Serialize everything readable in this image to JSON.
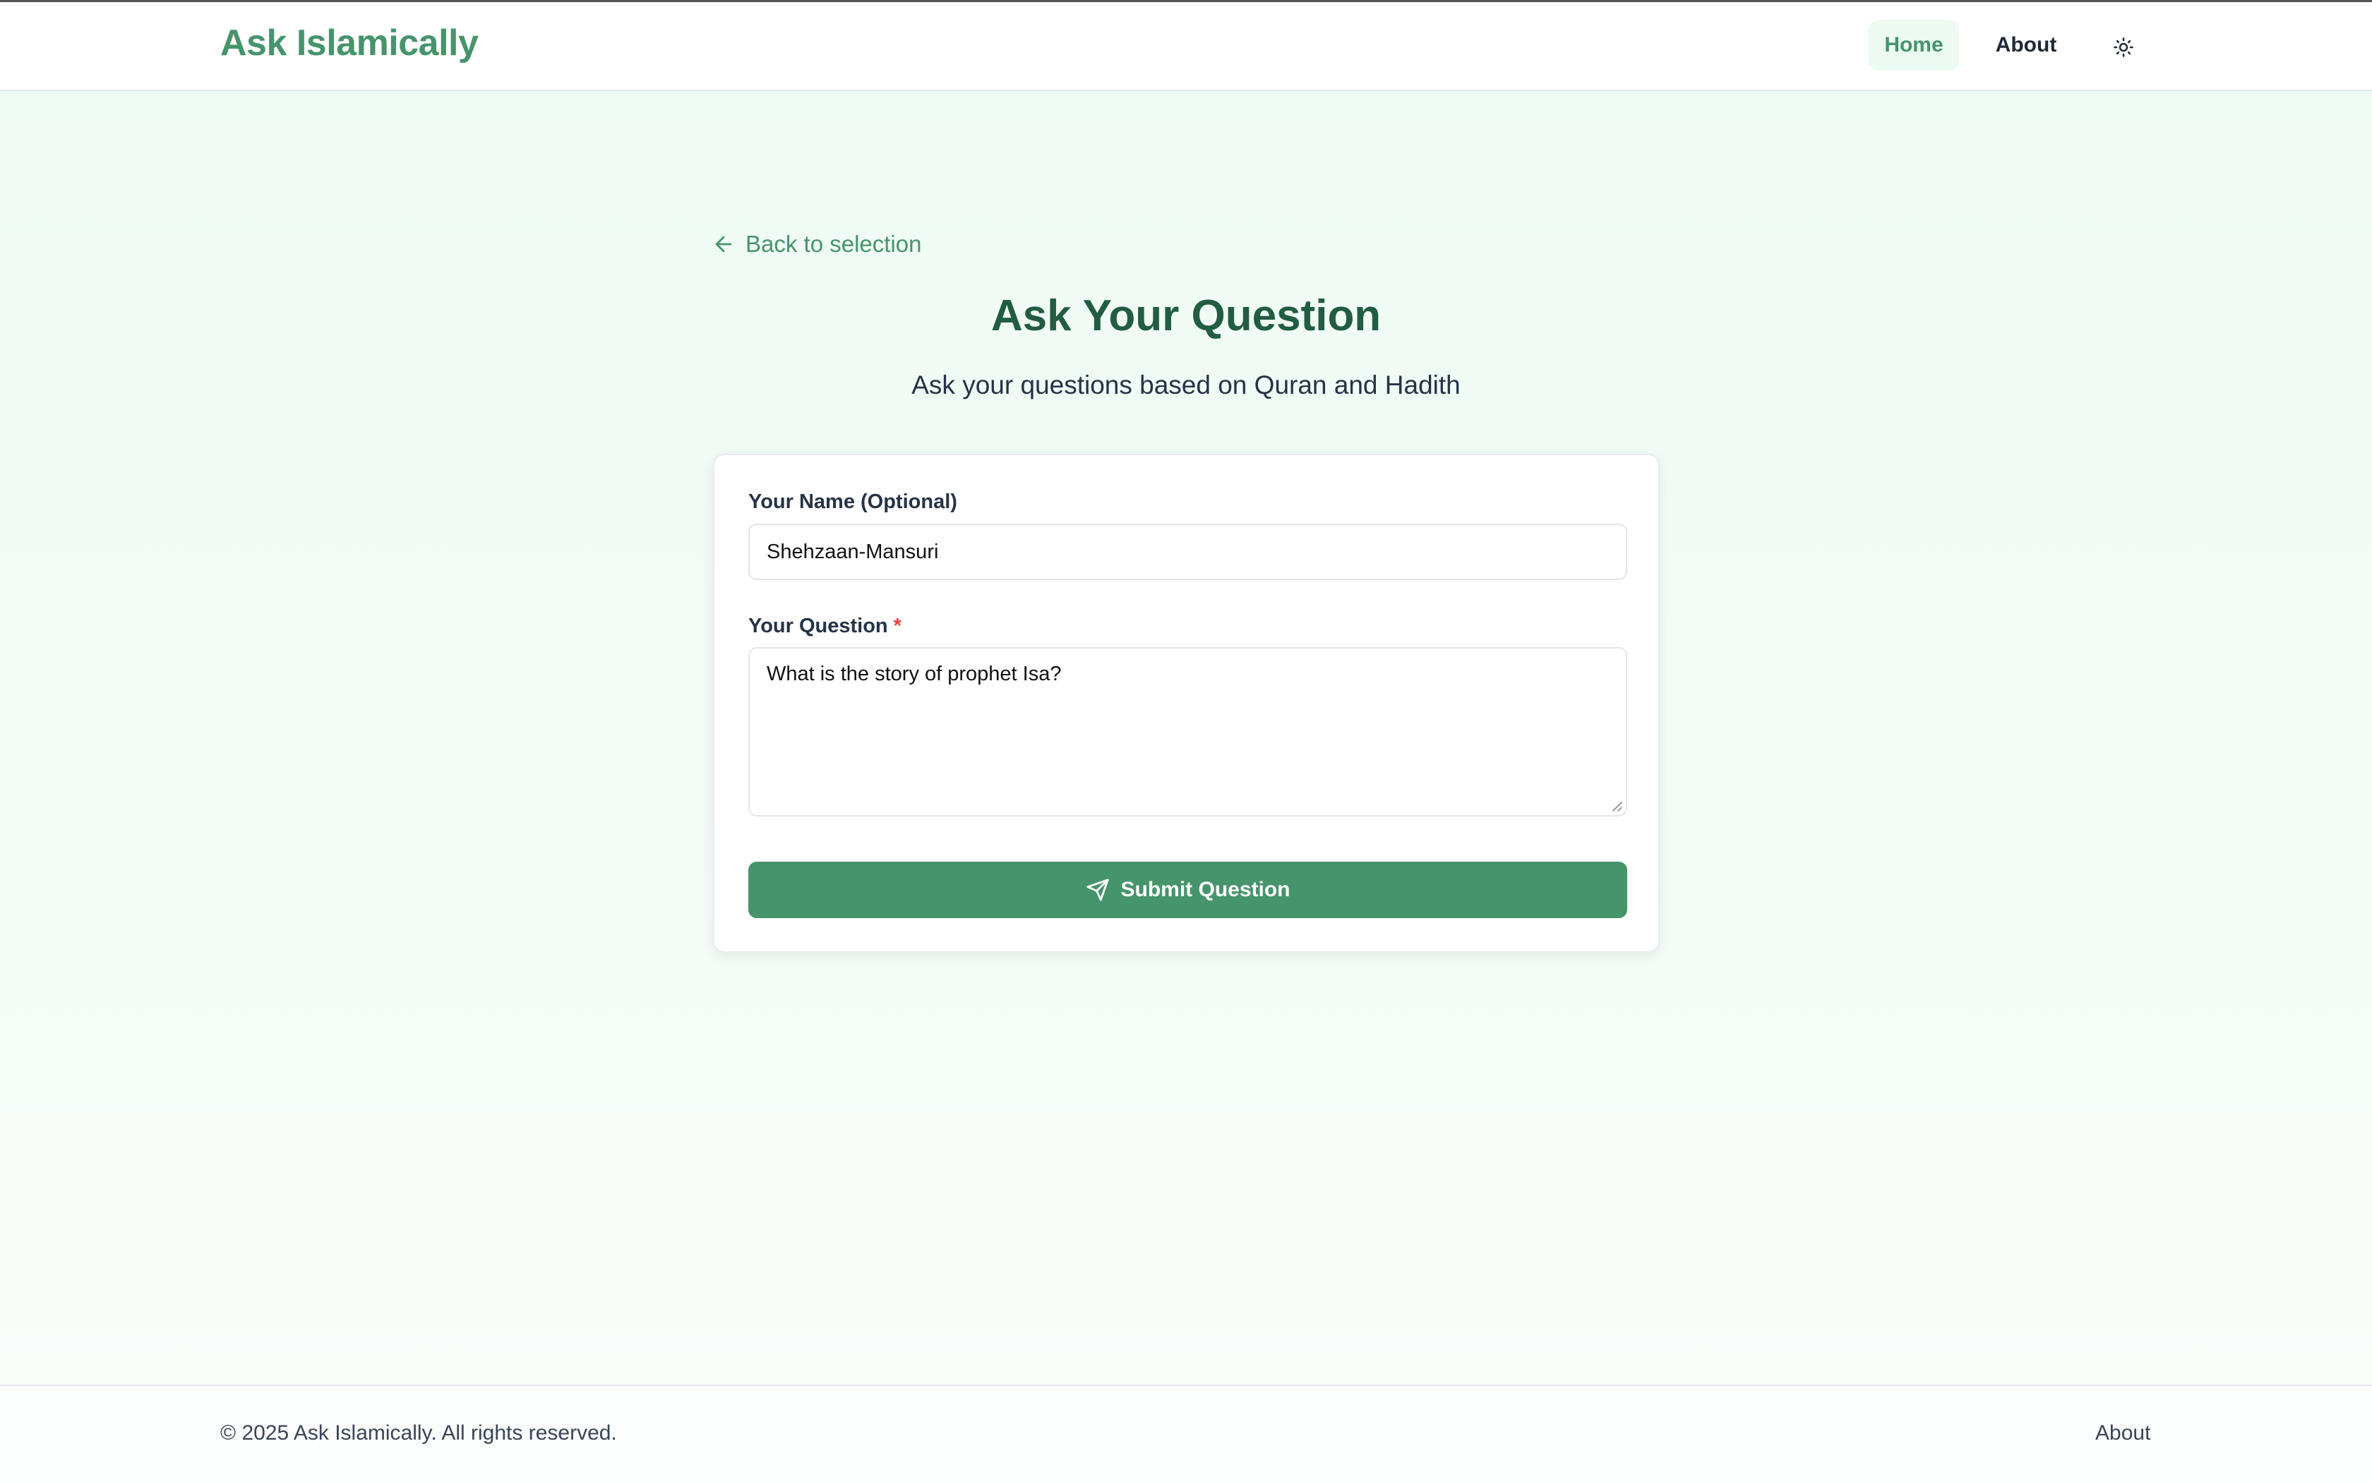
{
  "brand": {
    "name": "Ask Islamically"
  },
  "nav": {
    "home": "Home",
    "about": "About",
    "theme_icon": "sun-icon"
  },
  "back_link": {
    "label": "Back to selection",
    "icon": "arrow-left-icon"
  },
  "page": {
    "title": "Ask Your Question",
    "subtitle": "Ask your questions based on Quran and Hadith"
  },
  "form": {
    "name_label": "Your Name (Optional)",
    "name_value": "Shehzaan-Mansuri",
    "question_label": "Your Question",
    "required_marker": "*",
    "question_value": "What is the story of prophet Isa?",
    "submit_label": "Submit Question",
    "submit_icon": "send-icon"
  },
  "footer": {
    "copyright": "© 2025 Ask Islamically. All rights reserved.",
    "about": "About"
  },
  "colors": {
    "accent": "#46946c",
    "title": "#225c41",
    "required": "#e53e3e",
    "nav_active_bg": "#ecfaf1"
  }
}
